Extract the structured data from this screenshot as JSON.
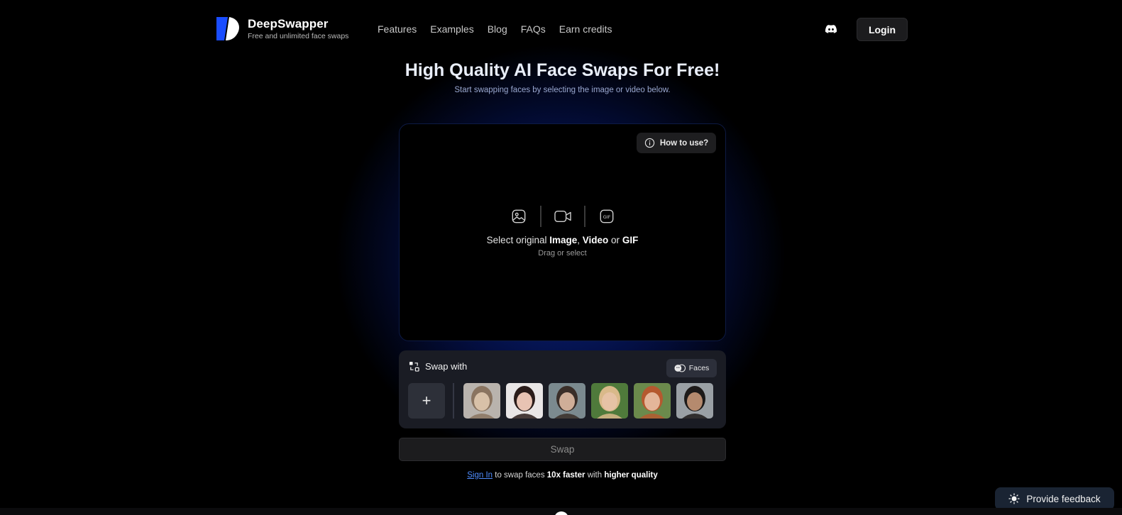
{
  "header": {
    "brand": "DeepSwapper",
    "tagline": "Free and unlimited face swaps",
    "nav": [
      "Features",
      "Examples",
      "Blog",
      "FAQs",
      "Earn credits"
    ],
    "login_label": "Login",
    "icons": {
      "logo": "deepswapper-logo",
      "community": "discord-icon"
    }
  },
  "hero": {
    "title_prefix": "High Quality ",
    "title_bold": "AI Face Swaps",
    "title_suffix": " For Free!",
    "subtitle": "Start swapping faces by selecting the image or video below."
  },
  "upload": {
    "how_to_label": "How to use?",
    "select_prefix": "Select original ",
    "select_image": "Image",
    "select_comma": ", ",
    "select_video": "Video",
    "select_or": " or ",
    "select_gif": "GIF",
    "drag_label": "Drag or select",
    "icons": [
      "image-icon",
      "video-icon",
      "gif-icon"
    ]
  },
  "swap_panel": {
    "title": "Swap with",
    "faces_button": "Faces",
    "add_label": "+",
    "faces": [
      {
        "colors": [
          "#b9b3ad",
          "#8a7460",
          "#d8c1a8"
        ]
      },
      {
        "colors": [
          "#e9e6e6",
          "#2a1c1a",
          "#e8c3b3"
        ]
      },
      {
        "colors": [
          "#7b8a8f",
          "#3a2e28",
          "#cfae98"
        ]
      },
      {
        "colors": [
          "#4f7a3b",
          "#d9b98a",
          "#e6c2a5"
        ]
      },
      {
        "colors": [
          "#6b8a4c",
          "#b5592f",
          "#e4b69a"
        ]
      },
      {
        "colors": [
          "#9aa0a5",
          "#1d1a19",
          "#b58a6e"
        ]
      }
    ]
  },
  "swap_button": "Swap",
  "signin": {
    "link": "Sign In",
    "text1": " to swap faces ",
    "bold1": "10x faster",
    "text2": " with ",
    "bold2": "higher quality"
  },
  "feedback_label": "Provide feedback",
  "colors": {
    "accent_blue": "#1446ff",
    "link_blue": "#4f8dff",
    "panel": "#1a1c24"
  }
}
